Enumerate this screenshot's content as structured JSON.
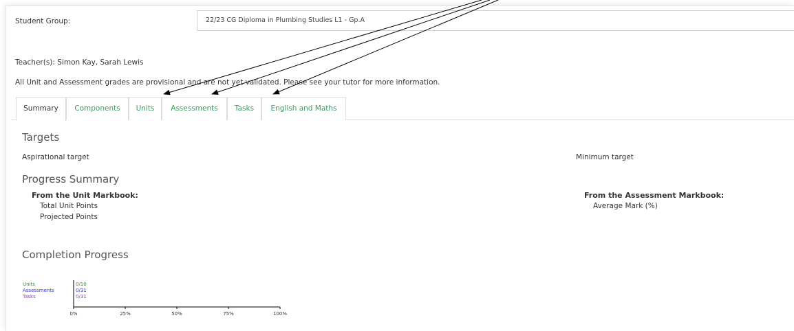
{
  "header": {
    "student_group_label": "Student Group:",
    "student_group_value": "22/23 CG Diploma in Plumbing Studies L1 - Gp.A",
    "teachers": "Teacher(s): Simon Kay, Sarah Lewis",
    "notice": "All Unit and Assessment grades are provisional and are not yet validated. Please see your tutor for more information."
  },
  "tabs": [
    {
      "label": "Summary",
      "active": true
    },
    {
      "label": "Components",
      "active": false
    },
    {
      "label": "Units",
      "active": false
    },
    {
      "label": "Assessments",
      "active": false
    },
    {
      "label": "Tasks",
      "active": false
    },
    {
      "label": "English and Maths",
      "active": false
    }
  ],
  "targets": {
    "heading": "Targets",
    "aspirational_label": "Aspirational target",
    "minimum_label": "Minimum target"
  },
  "progress_summary": {
    "heading": "Progress Summary",
    "unit_markbook_label": "From the Unit Markbook:",
    "total_unit_points_label": "Total Unit Points",
    "projected_points_label": "Projected Points",
    "assessment_markbook_label": "From the Assessment Markbook:",
    "average_mark_label": "Average Mark (%)"
  },
  "completion": {
    "heading": "Completion Progress"
  },
  "colors": {
    "tab_link": "#3c9a5f",
    "units": "#2e8b2e",
    "assessments": "#3333cc",
    "tasks": "#9933cc",
    "annotation_arrow": "#000000"
  },
  "chart_data": {
    "type": "bar",
    "orientation": "horizontal",
    "categories": [
      "Units",
      "Assessments",
      "Tasks"
    ],
    "values": [
      0,
      0,
      0
    ],
    "labels": [
      "0/10",
      "0/31",
      "0/31"
    ],
    "totals": [
      10,
      31,
      31
    ],
    "xticks": [
      "0%",
      "25%",
      "50%",
      "75%",
      "100%"
    ],
    "xlim": [
      0,
      100
    ],
    "grid": false
  }
}
